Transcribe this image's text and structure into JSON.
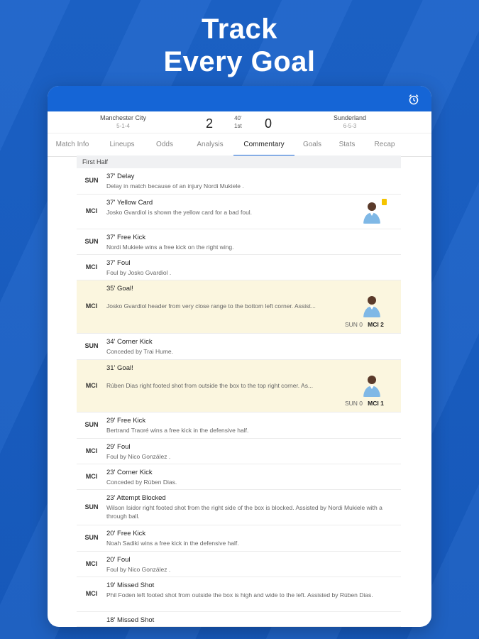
{
  "headline": {
    "line1": "Track",
    "line2": "Every Goal"
  },
  "colors": {
    "brand": "#1565d6",
    "background": "#1a5fc4",
    "goal_highlight": "#fbf6df",
    "yellow_card": "#f5c400"
  },
  "match": {
    "home": {
      "name": "Manchester City",
      "form": "5-1-4"
    },
    "away": {
      "name": "Sunderland",
      "form": "6-5-3"
    },
    "home_score": "2",
    "away_score": "0",
    "minute": "40'",
    "period": "1st"
  },
  "tabs": [
    "Match Info",
    "Lineups",
    "Odds",
    "Analysis",
    "Commentary",
    "Goals",
    "Stats",
    "Recap"
  ],
  "active_tab": "Commentary",
  "section_title": "First Half",
  "events": [
    {
      "team": "SUN",
      "minute": "37'",
      "title": "Delay",
      "desc": "Delay in match because of an injury Nordi Mukiele ."
    },
    {
      "team": "MCI",
      "minute": "37'",
      "title": "Yellow Card",
      "desc": "Josko Gvardiol is shown the yellow card for a bad foul.",
      "icon": "yellow-card-icon"
    },
    {
      "team": "SUN",
      "minute": "37'",
      "title": "Free Kick",
      "desc": "Nordi Mukiele wins a free kick on the right wing."
    },
    {
      "team": "MCI",
      "minute": "37'",
      "title": "Foul",
      "desc": "Foul by Josko Gvardiol ."
    },
    {
      "team": "MCI",
      "minute": "35'",
      "title": "Goal!",
      "desc": "Josko Gvardiol header from very close range to the bottom left corner. Assist...",
      "score_away_label": "SUN 0",
      "score_home_label": "MCI 2"
    },
    {
      "team": "SUN",
      "minute": "34'",
      "title": "Corner Kick",
      "desc": "Conceded by Trai Hume."
    },
    {
      "team": "MCI",
      "minute": "31'",
      "title": "Goal!",
      "desc": "Rúben Dias right footed shot from outside the box to the top right corner. As...",
      "score_away_label": "SUN 0",
      "score_home_label": "MCI 1"
    },
    {
      "team": "SUN",
      "minute": "29'",
      "title": "Free Kick",
      "desc": "Bertrand Traoré wins a free kick in the defensive half."
    },
    {
      "team": "MCI",
      "minute": "29'",
      "title": "Foul",
      "desc": "Foul by Nico González ."
    },
    {
      "team": "MCI",
      "minute": "23'",
      "title": "Corner Kick",
      "desc": "Conceded by Rúben Dias."
    },
    {
      "team": "SUN",
      "minute": "23'",
      "title": "Attempt Blocked",
      "desc": "Wilson Isidor right footed shot from the right side of the box is blocked. Assisted by Nordi Mukiele with a through ball."
    },
    {
      "team": "SUN",
      "minute": "20'",
      "title": "Free Kick",
      "desc": "Noah Sadiki wins a free kick in the defensive half."
    },
    {
      "team": "MCI",
      "minute": "20'",
      "title": "Foul",
      "desc": "Foul by Nico González ."
    },
    {
      "team": "MCI",
      "minute": "19'",
      "title": "Missed Shot",
      "desc": "Phil Foden left footed shot from outside the box is high and wide to the left. Assisted by Rúben Dias."
    },
    {
      "team": "",
      "minute": "18'",
      "title": "Missed Shot",
      "desc": ""
    }
  ]
}
